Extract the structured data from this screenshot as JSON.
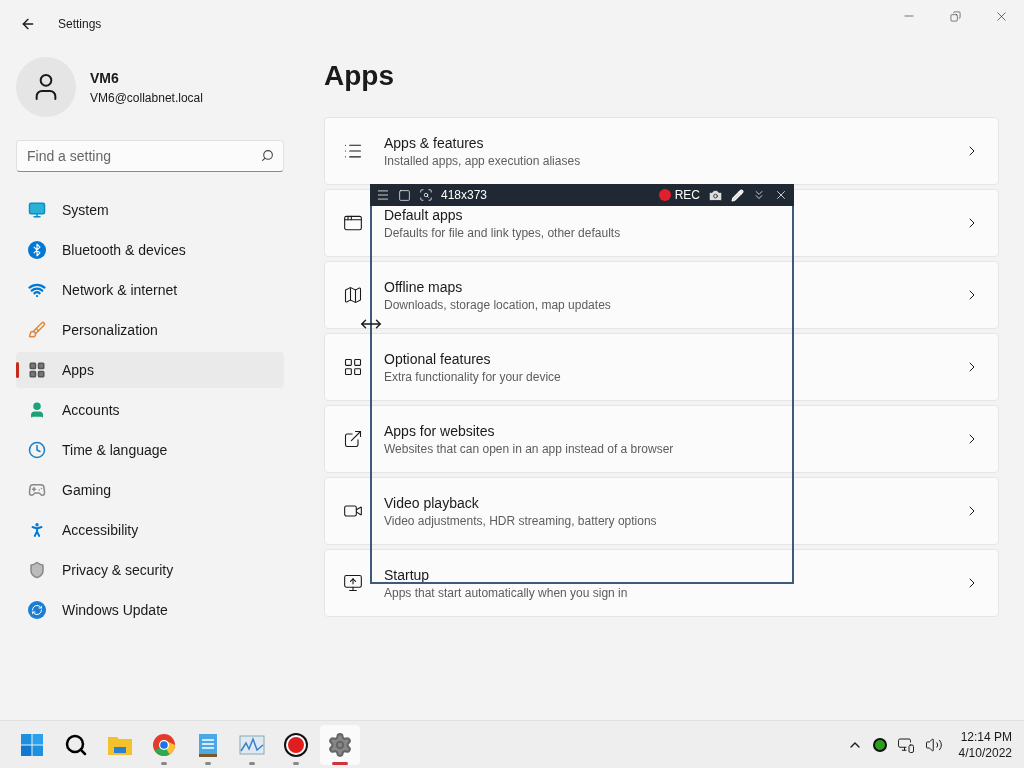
{
  "window": {
    "title": "Settings"
  },
  "user": {
    "name": "VM6",
    "email": "VM6@collabnet.local"
  },
  "search": {
    "placeholder": "Find a setting"
  },
  "nav": [
    {
      "label": "System",
      "selected": false
    },
    {
      "label": "Bluetooth & devices",
      "selected": false
    },
    {
      "label": "Network & internet",
      "selected": false
    },
    {
      "label": "Personalization",
      "selected": false
    },
    {
      "label": "Apps",
      "selected": true
    },
    {
      "label": "Accounts",
      "selected": false
    },
    {
      "label": "Time & language",
      "selected": false
    },
    {
      "label": "Gaming",
      "selected": false
    },
    {
      "label": "Accessibility",
      "selected": false
    },
    {
      "label": "Privacy & security",
      "selected": false
    },
    {
      "label": "Windows Update",
      "selected": false
    }
  ],
  "page_title": "Apps",
  "cards": [
    {
      "title": "Apps & features",
      "subtitle": "Installed apps, app execution aliases"
    },
    {
      "title": "Default apps",
      "subtitle": "Defaults for file and link types, other defaults"
    },
    {
      "title": "Offline maps",
      "subtitle": "Downloads, storage location, map updates"
    },
    {
      "title": "Optional features",
      "subtitle": "Extra functionality for your device"
    },
    {
      "title": "Apps for websites",
      "subtitle": "Websites that can open in an app instead of a browser"
    },
    {
      "title": "Video playback",
      "subtitle": "Video adjustments, HDR streaming, battery options"
    },
    {
      "title": "Startup",
      "subtitle": "Apps that start automatically when you sign in"
    }
  ],
  "recorder": {
    "size": "418x373",
    "rec_label": "REC"
  },
  "taskbar": {
    "apps": [
      {
        "kind": "start",
        "running": false,
        "selected": false
      },
      {
        "kind": "search",
        "running": false,
        "selected": false
      },
      {
        "kind": "folder",
        "running": false,
        "selected": false
      },
      {
        "kind": "browser",
        "running": true,
        "selected": false
      },
      {
        "kind": "notepad",
        "running": true,
        "selected": false
      },
      {
        "kind": "monitor",
        "running": true,
        "selected": false
      },
      {
        "kind": "record",
        "running": true,
        "selected": false
      },
      {
        "kind": "settings",
        "running": true,
        "selected": true
      }
    ],
    "time": "12:14 PM",
    "date": "4/10/2022"
  }
}
